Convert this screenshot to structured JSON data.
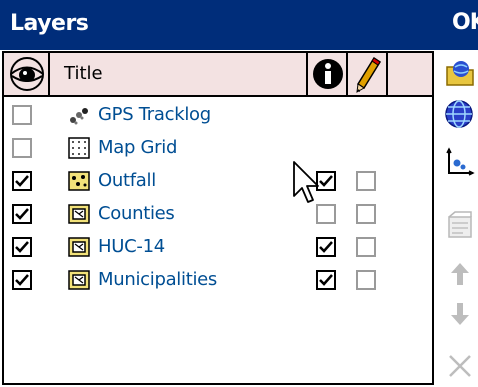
{
  "dialog": {
    "title": "Layers",
    "ok_label": "OK"
  },
  "columns": {
    "visibility_icon": "eye-icon",
    "title_header": "Title",
    "info_icon": "info-icon",
    "edit_icon": "pencil-icon"
  },
  "layers": [
    {
      "name": "GPS Tracklog",
      "icon": "gps-tracklog-icon",
      "visible": false,
      "info": null,
      "editable": null
    },
    {
      "name": "Map Grid",
      "icon": "map-grid-icon",
      "visible": false,
      "info": null,
      "editable": null
    },
    {
      "name": "Outfall",
      "icon": "point-layer-icon",
      "visible": true,
      "info": true,
      "editable": false
    },
    {
      "name": "Counties",
      "icon": "polygon-layer-icon",
      "visible": true,
      "info": false,
      "editable": false
    },
    {
      "name": "HUC-14",
      "icon": "polygon-layer-icon",
      "visible": true,
      "info": true,
      "editable": false
    },
    {
      "name": "Municipalities",
      "icon": "polygon-layer-icon",
      "visible": true,
      "info": true,
      "editable": false
    }
  ],
  "toolbar": {
    "add_layer_icon": "add-layer-folder-icon",
    "add_online_icon": "globe-icon",
    "projection_icon": "axes-icon",
    "properties_icon": "layer-properties-icon",
    "move_up_icon": "arrow-up-icon",
    "move_down_icon": "arrow-down-icon",
    "remove_icon": "close-icon"
  },
  "colors": {
    "titlebar": "#002d7a",
    "header": "#f3e2e2",
    "layer_text": "#004e93"
  }
}
